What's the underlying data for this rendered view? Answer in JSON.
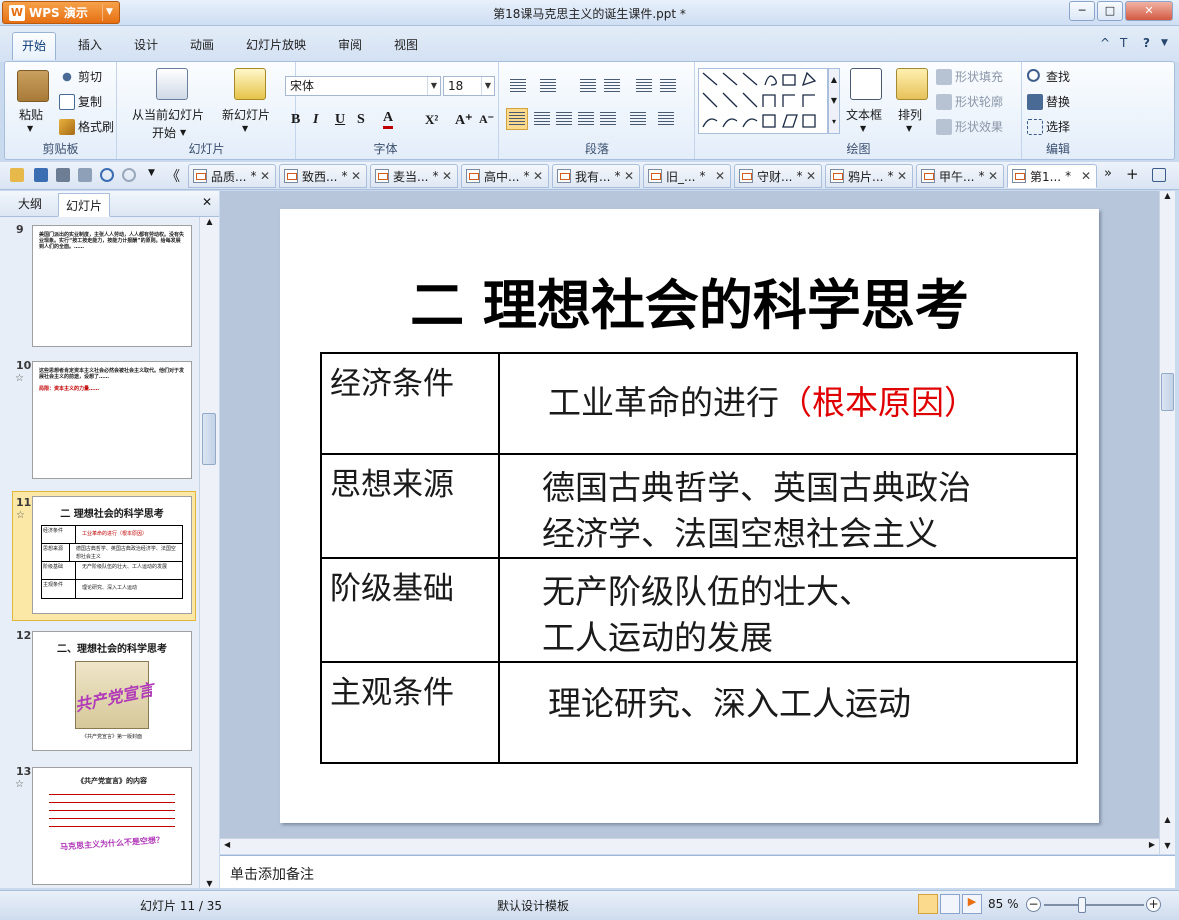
{
  "app": {
    "name": "WPS 演示",
    "logo_letter": "W",
    "window_title": "第18课马克思主义的诞生课件.ppt *"
  },
  "window_controls": [
    "─",
    "□",
    "✕"
  ],
  "ribbon_tabs": [
    {
      "label": "开始",
      "active": true
    },
    {
      "label": "插入"
    },
    {
      "label": "设计"
    },
    {
      "label": "动画"
    },
    {
      "label": "幻灯片放映"
    },
    {
      "label": "审阅"
    },
    {
      "label": "视图"
    }
  ],
  "ribbon_right": [
    "^",
    "T",
    "?"
  ],
  "groups": {
    "clipboard": {
      "label": "剪贴板",
      "paste": "粘贴",
      "cut": "剪切",
      "copy": "复制",
      "format_painter": "格式刷"
    },
    "slides": {
      "label": "幻灯片",
      "from_current_1": "从当前幻灯片",
      "from_current_2": "开始",
      "new_slide": "新幻灯片"
    },
    "font": {
      "label": "字体",
      "font_name": "宋体",
      "font_size": "18",
      "bold": "B",
      "italic": "I",
      "underline": "U",
      "strike": "S",
      "color": "A",
      "superscript": "X²",
      "grow": "A⁺",
      "shrink": "A⁻"
    },
    "paragraph": {
      "label": "段落"
    },
    "drawing": {
      "label": "绘图",
      "text_box": "文本框",
      "arrange": "排列",
      "shape_fill": "形状填充",
      "shape_outline": "形状轮廓",
      "shape_effect": "形状效果"
    },
    "edit": {
      "label": "编辑",
      "find": "查找",
      "replace": "替换",
      "select": "选择"
    }
  },
  "doc_tabs": [
    {
      "label": "品质...",
      "modified": "*"
    },
    {
      "label": "致西...",
      "modified": "*"
    },
    {
      "label": "麦当...",
      "modified": "*"
    },
    {
      "label": "高中...",
      "modified": "*"
    },
    {
      "label": "我有...",
      "modified": "*"
    },
    {
      "label": "旧_...",
      "modified": "*"
    },
    {
      "label": "守财...",
      "modified": "*"
    },
    {
      "label": "鸦片...",
      "modified": "*"
    },
    {
      "label": "甲午...",
      "modified": "*"
    },
    {
      "label": "第1...",
      "modified": "*",
      "active": true
    }
  ],
  "left_panel": {
    "tabs": [
      {
        "label": "大纲"
      },
      {
        "label": "幻灯片",
        "active": true
      }
    ],
    "close": "✕",
    "thumbs": [
      {
        "num": "9",
        "text": "美国门派出的实业制度，主张人人劳动，人人都有劳动权。没有失业现象。实行“按工按走能力，按能力计报酬”的原则。给每发展到人们的全面。……"
      },
      {
        "num": "10",
        "text": "这些思想者肯定资本主义社会必然会被社会主义取代。他们对于发展社会主义的前途，设想了……",
        "sub": "局限：资本主义的力量……"
      },
      {
        "num": "11",
        "title": "二 理想社会的科学思考",
        "rows": [
          [
            "经济条件",
            "工业革命的进行（根本原因）"
          ],
          [
            "思想来源",
            "德国古典哲学、英国古典政治经济学、法国空想社会主义"
          ],
          [
            "阶级基础",
            "无产阶级队伍的壮大、工人运动的发展"
          ],
          [
            "主观条件",
            "理论研究、深入工人运动"
          ]
        ]
      },
      {
        "num": "12",
        "title": "二、理想社会的科学思考",
        "art": "共产党宣言",
        "caption": "《共产党宣言》第一版封面"
      },
      {
        "num": "13",
        "title": "《共产党宣言》的内容",
        "art": "马克思主义为什么不是空想？"
      }
    ]
  },
  "slide": {
    "title": "二  理想社会的科学思考",
    "rows": [
      {
        "key": "经济条件",
        "value": "工业革命的进行",
        "note": "（根本原因）"
      },
      {
        "key": "思想来源",
        "value": "德国古典哲学、英国古典政治",
        "value2": "经济学、法国空想社会主义"
      },
      {
        "key": "阶级基础",
        "value": "无产阶级队伍的壮大、",
        "value2": "工人运动的发展"
      },
      {
        "key": "主观条件",
        "value": "理论研究、深入工人运动"
      }
    ]
  },
  "notes_placeholder": "单击添加备注",
  "status": {
    "slide_info": "幻灯片 11 / 35",
    "template": "默认设计模板",
    "zoom": "85 %"
  },
  "colors": {
    "accent": "#e66f12",
    "red_text": "#e00000",
    "ribbon_bg": "#e3edf9"
  }
}
